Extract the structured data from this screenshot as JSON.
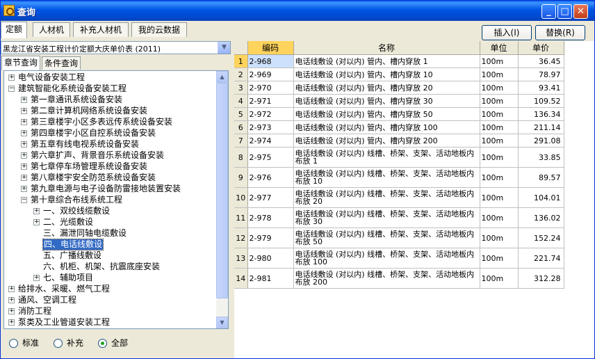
{
  "window": {
    "title": "查询",
    "buttons": {
      "minimize": "_",
      "maximize": "□",
      "close": "✕"
    }
  },
  "top_tabs": [
    "定额",
    "人材机",
    "补充人材机",
    "我的云数据"
  ],
  "actions": {
    "insert": "插入(I)",
    "replace": "替换(R)"
  },
  "left": {
    "selected_library": "黑龙江省安装工程计价定额大庆单价表 (2011)",
    "sub_tabs": [
      "章节查询",
      "条件查询"
    ],
    "tree": [
      {
        "label": "电气设备安装工程",
        "level": 0,
        "exp": "+"
      },
      {
        "label": "建筑智能化系统设备安装工程",
        "level": 0,
        "exp": "-"
      },
      {
        "label": "第一章通讯系统设备安装",
        "level": 1,
        "exp": "+"
      },
      {
        "label": "第二章计算机网络系统设备安装",
        "level": 1,
        "exp": "+"
      },
      {
        "label": "第三章楼宇小区多表远传系统设备安装",
        "level": 1,
        "exp": "+"
      },
      {
        "label": "第四章楼宇小区自控系统设备安装",
        "level": 1,
        "exp": "+"
      },
      {
        "label": "第五章有线电视系统设备安装",
        "level": 1,
        "exp": "+"
      },
      {
        "label": "第六章扩声、背景音乐系统设备安装",
        "level": 1,
        "exp": "+"
      },
      {
        "label": "第七章停车场管理系统设备安装",
        "level": 1,
        "exp": "+"
      },
      {
        "label": "第八章楼宇安全防范系统设备安装",
        "level": 1,
        "exp": "+"
      },
      {
        "label": "第九章电源与电子设备防雷接地装置安装",
        "level": 1,
        "exp": "+"
      },
      {
        "label": "第十章综合布线系统工程",
        "level": 1,
        "exp": "-"
      },
      {
        "label": "一、双绞线缆敷设",
        "level": 2,
        "exp": "+"
      },
      {
        "label": "二、光缆敷设",
        "level": 2,
        "exp": "+"
      },
      {
        "label": "三、漏泄同轴电缆敷设",
        "level": 2,
        "exp": ""
      },
      {
        "label": "四、电话线敷设",
        "level": 2,
        "exp": "",
        "selected": true
      },
      {
        "label": "五、广播线敷设",
        "level": 2,
        "exp": ""
      },
      {
        "label": "六、机柜、机架、抗震底座安装",
        "level": 2,
        "exp": ""
      },
      {
        "label": "七、辅助项目",
        "level": 2,
        "exp": "+"
      },
      {
        "label": "给排水、采暖、燃气工程",
        "level": 0,
        "exp": "+"
      },
      {
        "label": "通风、空调工程",
        "level": 0,
        "exp": "+"
      },
      {
        "label": "消防工程",
        "level": 0,
        "exp": "+"
      },
      {
        "label": "泵类及工业管道安装工程",
        "level": 0,
        "exp": "+"
      }
    ],
    "filter": {
      "options": [
        "标准",
        "补充",
        "全部"
      ],
      "selected": "全部"
    }
  },
  "grid": {
    "headers": {
      "index": "",
      "code": "编码",
      "name": "名称",
      "unit": "单位",
      "price": "单价"
    },
    "rows": [
      {
        "i": "1",
        "code": "2-968",
        "name": "电话线敷设 (对以内) 管内、槽内穿放 1",
        "unit": "100m",
        "price": "36.45"
      },
      {
        "i": "2",
        "code": "2-969",
        "name": "电话线敷设 (对以内) 管内、槽内穿放 10",
        "unit": "100m",
        "price": "78.97"
      },
      {
        "i": "3",
        "code": "2-970",
        "name": "电话线敷设 (对以内) 管内、槽内穿放 20",
        "unit": "100m",
        "price": "93.41"
      },
      {
        "i": "4",
        "code": "2-971",
        "name": "电话线敷设 (对以内) 管内、槽内穿放 30",
        "unit": "100m",
        "price": "109.52"
      },
      {
        "i": "5",
        "code": "2-972",
        "name": "电话线敷设 (对以内) 管内、槽内穿放 50",
        "unit": "100m",
        "price": "136.34"
      },
      {
        "i": "6",
        "code": "2-973",
        "name": "电话线敷设 (对以内) 管内、槽内穿放 100",
        "unit": "100m",
        "price": "211.14"
      },
      {
        "i": "7",
        "code": "2-974",
        "name": "电话线敷设 (对以内) 管内、槽内穿放 200",
        "unit": "100m",
        "price": "291.08"
      },
      {
        "i": "8",
        "code": "2-975",
        "name": "电话线敷设 (对以内) 线槽、桥架、支架、活动地板内布放 1",
        "unit": "100m",
        "price": "33.85"
      },
      {
        "i": "9",
        "code": "2-976",
        "name": "电话线敷设 (对以内) 线槽、桥架、支架、活动地板内布放 10",
        "unit": "100m",
        "price": "89.57"
      },
      {
        "i": "10",
        "code": "2-977",
        "name": "电话线敷设 (对以内) 线槽、桥架、支架、活动地板内布放 20",
        "unit": "100m",
        "price": "104.01"
      },
      {
        "i": "11",
        "code": "2-978",
        "name": "电话线敷设 (对以内) 线槽、桥架、支架、活动地板内布放 30",
        "unit": "100m",
        "price": "136.02"
      },
      {
        "i": "12",
        "code": "2-979",
        "name": "电话线敷设 (对以内) 线槽、桥架、支架、活动地板内布放 50",
        "unit": "100m",
        "price": "152.24"
      },
      {
        "i": "13",
        "code": "2-980",
        "name": "电话线敷设 (对以内) 线槽、桥架、支架、活动地板内布放 100",
        "unit": "100m",
        "price": "221.74"
      },
      {
        "i": "14",
        "code": "2-981",
        "name": "电话线敷设 (对以内) 线槽、桥架、支架、活动地板内布放 200",
        "unit": "100m",
        "price": "312.28"
      }
    ]
  }
}
